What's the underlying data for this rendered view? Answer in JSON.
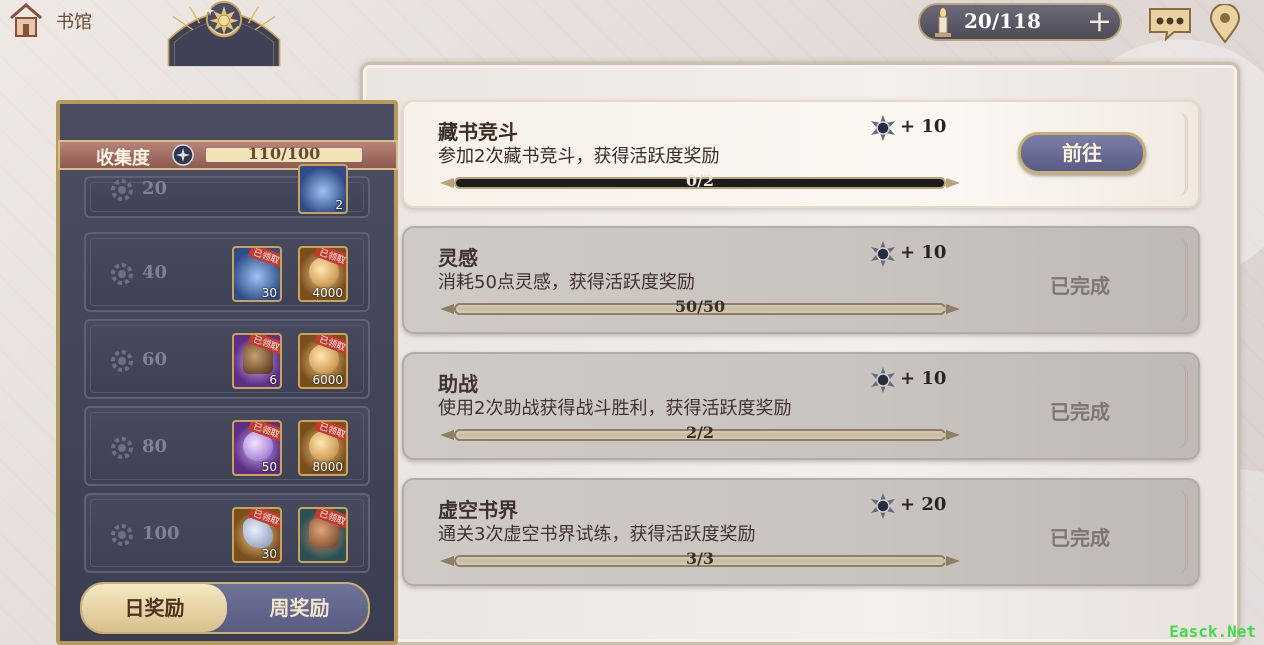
{
  "header": {
    "home_label": "书馆",
    "home_icon": "home-icon"
  },
  "resource": {
    "value": "20/118",
    "icon": "candle-icon",
    "plus": "+"
  },
  "collection": {
    "label": "收集度",
    "value": "110/100",
    "progress": 1.0
  },
  "milestones": [
    {
      "value": "20",
      "items": [
        {
          "count": "2",
          "claimed": false,
          "style": "blue"
        }
      ]
    },
    {
      "value": "40",
      "items": [
        {
          "count": "30",
          "claimed": true,
          "tag": "已领取",
          "style": "blue"
        },
        {
          "count": "4000",
          "claimed": true,
          "tag": "已领取",
          "style": "gold"
        }
      ]
    },
    {
      "value": "60",
      "items": [
        {
          "count": "6",
          "claimed": true,
          "tag": "已领取",
          "style": "purple"
        },
        {
          "count": "6000",
          "claimed": true,
          "tag": "已领取",
          "style": "gold"
        }
      ]
    },
    {
      "value": "80",
      "items": [
        {
          "count": "50",
          "claimed": true,
          "tag": "已领取",
          "style": "purple"
        },
        {
          "count": "8000",
          "claimed": true,
          "tag": "已领取",
          "style": "gold"
        }
      ]
    },
    {
      "value": "100",
      "items": [
        {
          "count": "30",
          "claimed": true,
          "tag": "已领取",
          "style": "gold"
        },
        {
          "count": "",
          "claimed": true,
          "tag": "已领取",
          "style": "teal"
        }
      ]
    }
  ],
  "tabs": {
    "daily": "日奖励",
    "weekly": "周奖励"
  },
  "tasks": [
    {
      "title": "藏书竞斗",
      "desc": "参加2次藏书竞斗，获得活跃度奖励",
      "reward": "+ 10",
      "progress_text": "0/2",
      "progress": 0.0,
      "status": "go",
      "action": "前往"
    },
    {
      "title": "灵感",
      "desc": "消耗50点灵感，获得活跃度奖励",
      "reward": "+ 10",
      "progress_text": "50/50",
      "progress": 1.0,
      "status": "done",
      "action": "已完成"
    },
    {
      "title": "助战",
      "desc": "使用2次助战获得战斗胜利，获得活跃度奖励",
      "reward": "+ 10",
      "progress_text": "2/2",
      "progress": 1.0,
      "status": "done",
      "action": "已完成"
    },
    {
      "title": "虚空书界",
      "desc": "通关3次虚空书界试练，获得活跃度奖励",
      "reward": "+ 20",
      "progress_text": "3/3",
      "progress": 1.0,
      "status": "done",
      "action": "已完成"
    }
  ],
  "watermark": "Easck.Net",
  "colors": {
    "accent_gold": "#c9ae74",
    "panel_navy": "#3e4155",
    "button_purple": "#585b85"
  }
}
